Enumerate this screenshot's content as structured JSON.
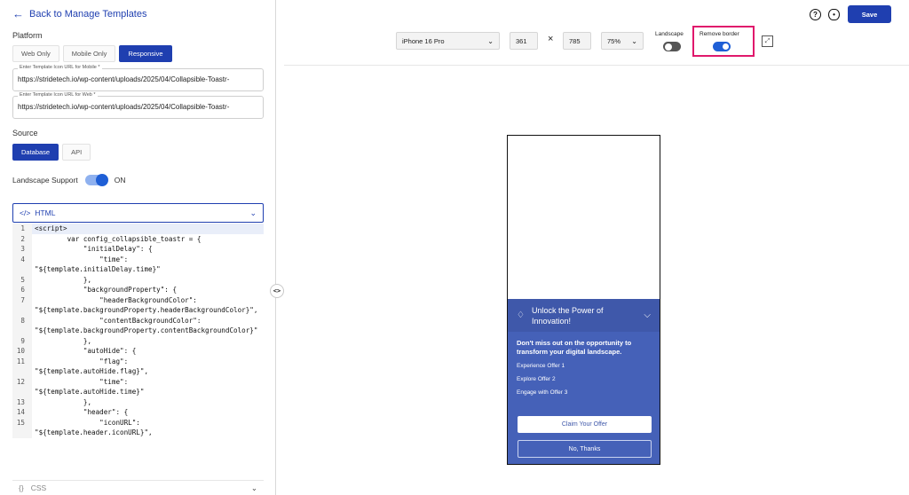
{
  "nav": {
    "back_label": "Back to Manage Templates"
  },
  "platform": {
    "label": "Platform",
    "options": [
      "Web Only",
      "Mobile Only",
      "Responsive"
    ],
    "selected": "Responsive"
  },
  "mobile_url": {
    "label": "Enter Template Icon URL for Mobile *",
    "value": "https://stridetech.io/wp-content/uploads/2025/04/Collapsible-Toastr-"
  },
  "web_url": {
    "label": "Enter Template Icon URL for Web *",
    "value": "https://stridetech.io/wp-content/uploads/2025/04/Collapsible-Toastr-"
  },
  "source": {
    "label": "Source",
    "options": [
      "Database",
      "API"
    ],
    "selected": "Database"
  },
  "landscape_support": {
    "label": "Landscape Support",
    "state": "ON"
  },
  "html_editor": {
    "tab_label": "HTML",
    "lines": [
      {
        "n": "1",
        "text": "<script>"
      },
      {
        "n": "2",
        "text": "        var config_collapsible_toastr = {"
      },
      {
        "n": "3",
        "text": "            \"initialDelay\": {"
      },
      {
        "n": "4",
        "text": "                \"time\":\n\"${template.initialDelay.time}\""
      },
      {
        "n": "5",
        "text": "            },"
      },
      {
        "n": "6",
        "text": "            \"backgroundProperty\": {"
      },
      {
        "n": "7",
        "text": "                \"headerBackgroundColor\":\n\"${template.backgroundProperty.headerBackgroundColor}\","
      },
      {
        "n": "8",
        "text": "                \"contentBackgroundColor\":\n\"${template.backgroundProperty.contentBackgroundColor}\""
      },
      {
        "n": "9",
        "text": "            },"
      },
      {
        "n": "10",
        "text": "            \"autoHide\": {"
      },
      {
        "n": "11",
        "text": "                \"flag\":\n\"${template.autoHide.flag}\","
      },
      {
        "n": "12",
        "text": "                \"time\":\n\"${template.autoHide.time}\""
      },
      {
        "n": "13",
        "text": "            },"
      },
      {
        "n": "14",
        "text": "            \"header\": {"
      },
      {
        "n": "15",
        "text": "                \"iconURL\":\n\"${template.header.iconURL}\","
      }
    ]
  },
  "css_editor": {
    "tab_label": "CSS"
  },
  "toolbar": {
    "device": "iPhone 16 Pro",
    "width": "361",
    "times": "×",
    "height": "785",
    "zoom": "75%",
    "landscape_label": "Landscape",
    "remove_border_label": "Remove border",
    "save_label": "Save"
  },
  "preview": {
    "title": "Unlock the Power of Innovation!",
    "headline": "Don't miss out on the opportunity to transform your digital landscape.",
    "offers": [
      "Experience Offer 1",
      "Explore Offer 2",
      "Engage with Offer 3"
    ],
    "primary_button": "Claim Your Offer",
    "secondary_button": "No, Thanks"
  },
  "colors": {
    "accent": "#1f3fb0",
    "toast_bg": "#4561b8",
    "highlight": "#e0186c"
  },
  "icons": [
    "arrow-left-icon",
    "help-icon",
    "eye-icon",
    "code-icon",
    "chevron-down-icon",
    "braces-icon",
    "expand-icon",
    "bell-icon",
    "splitter-icon"
  ]
}
